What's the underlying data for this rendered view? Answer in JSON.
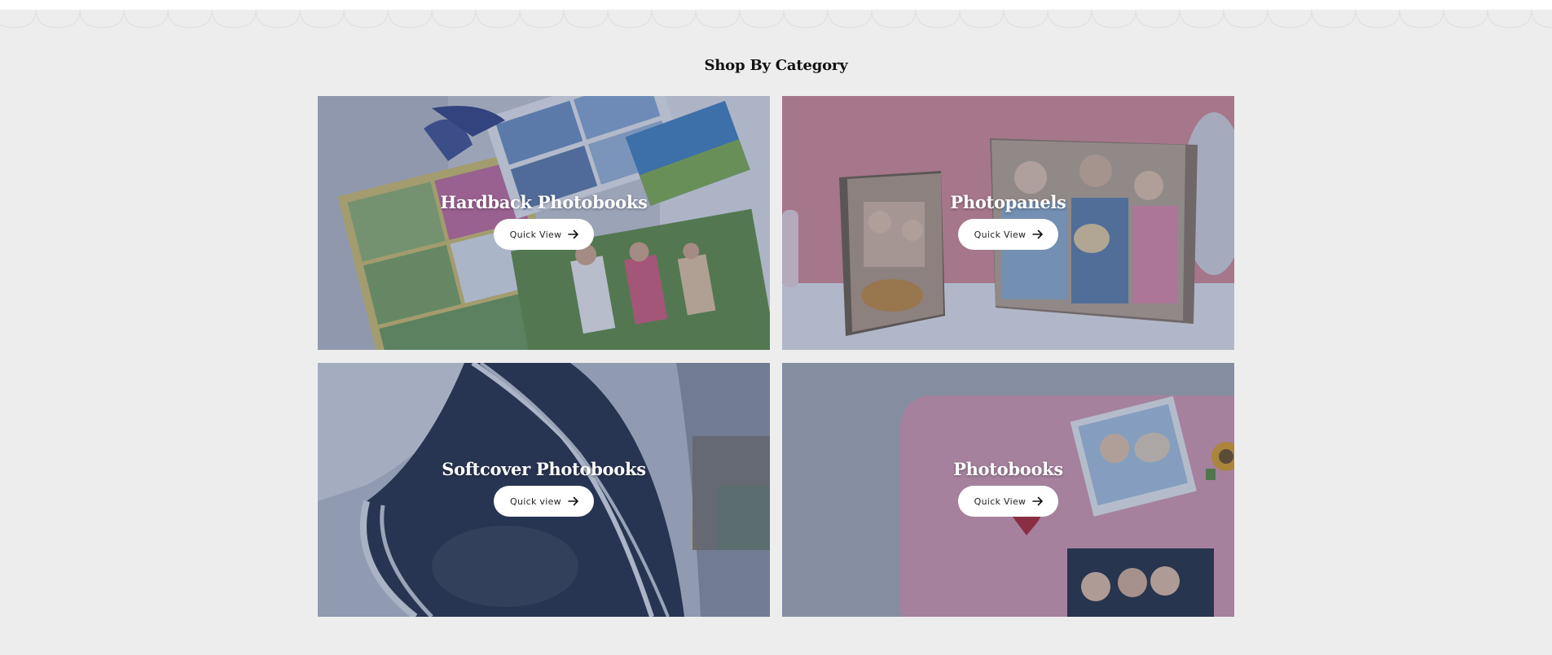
{
  "section": {
    "title": "Shop By Category"
  },
  "categories": [
    {
      "title": "Hardback Photobooks",
      "button": "Quick View",
      "arrow_icon": "arrow-right-icon"
    },
    {
      "title": "Photopanels",
      "button": "Quick View",
      "arrow_icon": "arrow-right-icon"
    },
    {
      "title": "Softcover Photobooks",
      "button": "Quick view",
      "arrow_icon": "arrow-right-icon"
    },
    {
      "title": "Photobooks",
      "button": "Quick View",
      "arrow_icon": "arrow-right-icon"
    }
  ],
  "colors": {
    "page_background": "#ededed",
    "scallop": "#ffffff",
    "overlay": "#3c4e78",
    "button_background": "#ffffff",
    "title_text": "#ffffff"
  }
}
